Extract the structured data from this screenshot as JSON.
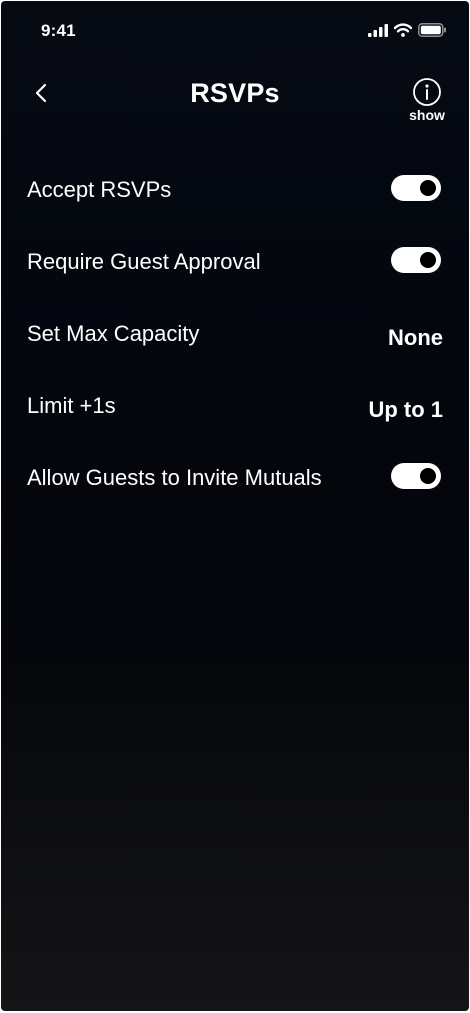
{
  "status_bar": {
    "time": "9:41",
    "icons": [
      "signal-icon",
      "wifi-icon",
      "battery-icon"
    ]
  },
  "nav": {
    "title": "RSVPs",
    "back_icon": "chevron-left-icon",
    "info_icon": "info-icon",
    "info_label": "show"
  },
  "settings": [
    {
      "label": "Accept RSVPs",
      "type": "toggle",
      "enabled": true
    },
    {
      "label": "Require Guest Approval",
      "type": "toggle",
      "enabled": true
    },
    {
      "label": "Set Max Capacity",
      "type": "value",
      "value": "None"
    },
    {
      "label": "Limit +1s",
      "type": "value",
      "value": "Up to 1"
    },
    {
      "label": "Allow Guests to Invite Mutuals",
      "type": "toggle",
      "enabled": true
    }
  ],
  "colors": {
    "background": "#05070c",
    "text": "#ffffff",
    "toggle_track": "#ffffff",
    "toggle_knob": "#000000"
  }
}
